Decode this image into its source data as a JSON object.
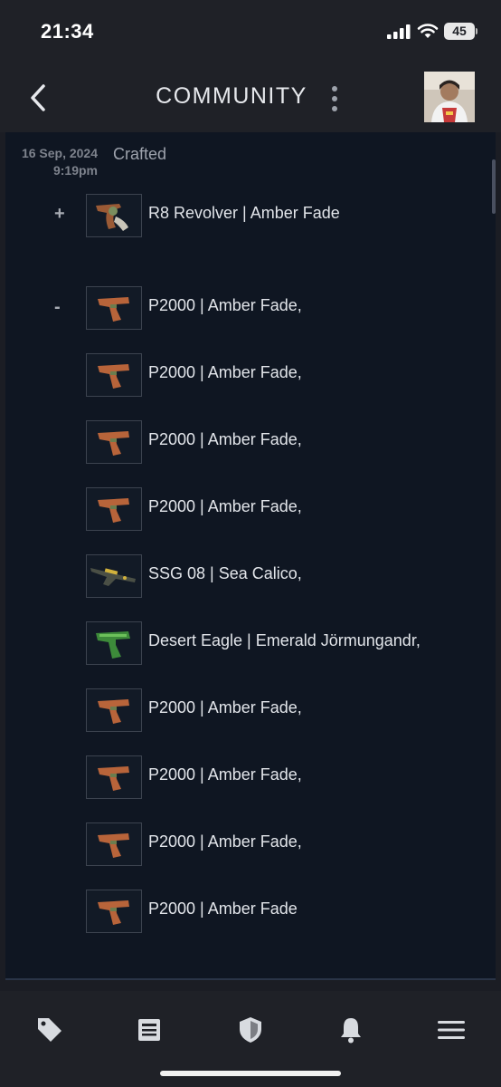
{
  "status": {
    "time": "21:34",
    "battery": "45"
  },
  "header": {
    "title": "COMMUNITY"
  },
  "entry": {
    "date": "16 Sep, 2024",
    "time": "9:19pm",
    "action": "Crafted",
    "plus_sign": "+",
    "minus_sign": "-",
    "received": [
      {
        "name": "R8 Revolver | Amber Fade",
        "icon": "revolver-amber"
      }
    ],
    "consumed": [
      {
        "name": "P2000 | Amber Fade,",
        "icon": "pistol-amber"
      },
      {
        "name": "P2000 | Amber Fade,",
        "icon": "pistol-amber"
      },
      {
        "name": "P2000 | Amber Fade,",
        "icon": "pistol-amber"
      },
      {
        "name": "P2000 | Amber Fade,",
        "icon": "pistol-amber"
      },
      {
        "name": "SSG 08 | Sea Calico,",
        "icon": "sniper-calico"
      },
      {
        "name": "Desert Eagle | Emerald Jörmungandr,",
        "icon": "deagle-emerald"
      },
      {
        "name": "P2000 | Amber Fade,",
        "icon": "pistol-amber"
      },
      {
        "name": "P2000 | Amber Fade,",
        "icon": "pistol-amber"
      },
      {
        "name": "P2000 | Amber Fade,",
        "icon": "pistol-amber"
      },
      {
        "name": "P2000 | Amber Fade",
        "icon": "pistol-amber"
      }
    ]
  },
  "tabs": [
    {
      "name": "tag-icon"
    },
    {
      "name": "news-icon"
    },
    {
      "name": "shield-icon"
    },
    {
      "name": "bell-icon"
    },
    {
      "name": "menu-icon"
    }
  ],
  "colors": {
    "accent_amber": "#b8643a",
    "emerald": "#3d8a3a",
    "bg": "#0f1622"
  }
}
